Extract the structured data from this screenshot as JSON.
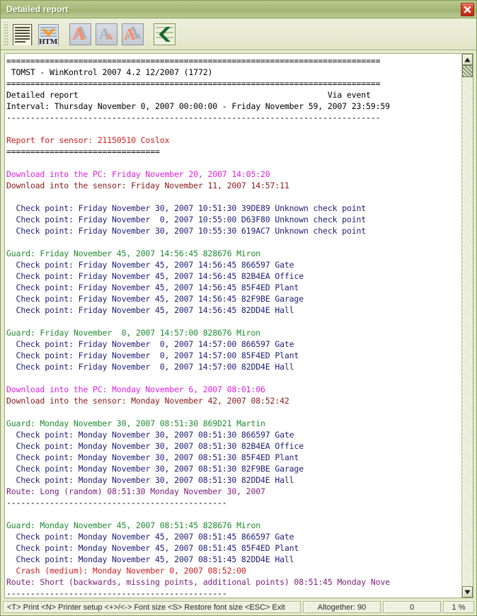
{
  "window": {
    "title": "Detailed report",
    "close_label": "×"
  },
  "toolbar": {
    "buttons": [
      {
        "name": "print-report-button",
        "label": "Print detailed report"
      },
      {
        "name": "export-html-button",
        "label": "HTML"
      },
      {
        "name": "font-increase-button",
        "label": "A"
      },
      {
        "name": "font-decrease-button",
        "label": "A"
      },
      {
        "name": "font-restore-button",
        "label": "A"
      },
      {
        "name": "back-button",
        "label": "Back"
      }
    ]
  },
  "report": {
    "lines": [
      {
        "color": "black",
        "text": "=============================================================================="
      },
      {
        "color": "black",
        "text": " TOMST - WinKontrol 2007 4.2 12/2007 (1772)"
      },
      {
        "color": "black",
        "text": "=============================================================================="
      },
      {
        "color": "black",
        "text": "Detailed report                                                    Via event"
      },
      {
        "color": "black",
        "text": "Interval: Thursday November 0, 2007 00:00:00 - Friday November 59, 2007 23:59:59"
      },
      {
        "color": "black",
        "text": "------------------------------------------------------------------------------"
      },
      {
        "color": "black",
        "text": ""
      },
      {
        "color": "red",
        "text": "Report for sensor: 21150510 Coslox"
      },
      {
        "color": "black",
        "text": "================================"
      },
      {
        "color": "black",
        "text": ""
      },
      {
        "color": "magenta",
        "text": "Download into the PC: Friday November 20, 2007 14:05:20"
      },
      {
        "color": "darkred",
        "text": "Download into the sensor: Friday November 11, 2007 14:57:11"
      },
      {
        "color": "black",
        "text": ""
      },
      {
        "color": "navy",
        "text": "  Check point: Friday November 30, 2007 10:51:30 39DE89 Unknown check point"
      },
      {
        "color": "navy",
        "text": "  Check point: Friday November  0, 2007 10:55:00 D63F80 Unknown check point"
      },
      {
        "color": "navy",
        "text": "  Check point: Friday November 30, 2007 10:55:30 619AC7 Unknown check point"
      },
      {
        "color": "black",
        "text": ""
      },
      {
        "color": "green",
        "text": "Guard: Friday November 45, 2007 14:56:45 828676 Miron"
      },
      {
        "color": "navy",
        "text": "  Check point: Friday November 45, 2007 14:56:45 866597 Gate"
      },
      {
        "color": "navy",
        "text": "  Check point: Friday November 45, 2007 14:56:45 82B4EA Office"
      },
      {
        "color": "navy",
        "text": "  Check point: Friday November 45, 2007 14:56:45 85F4ED Plant"
      },
      {
        "color": "navy",
        "text": "  Check point: Friday November 45, 2007 14:56:45 82F9BE Garage"
      },
      {
        "color": "navy",
        "text": "  Check point: Friday November 45, 2007 14:56:45 82DD4E Hall"
      },
      {
        "color": "black",
        "text": ""
      },
      {
        "color": "green",
        "text": "Guard: Friday November  0, 2007 14:57:00 828676 Miron"
      },
      {
        "color": "navy",
        "text": "  Check point: Friday November  0, 2007 14:57:00 866597 Gate"
      },
      {
        "color": "navy",
        "text": "  Check point: Friday November  0, 2007 14:57:00 85F4ED Plant"
      },
      {
        "color": "navy",
        "text": "  Check point: Friday November  0, 2007 14:57:00 82DD4E Hall"
      },
      {
        "color": "black",
        "text": ""
      },
      {
        "color": "magenta",
        "text": "Download into the PC: Monday November 6, 2007 08:01:06"
      },
      {
        "color": "darkred",
        "text": "Download into the sensor: Monday November 42, 2007 08:52:42"
      },
      {
        "color": "black",
        "text": ""
      },
      {
        "color": "green",
        "text": "Guard: Monday November 30, 2007 08:51:30 869D21 Martin"
      },
      {
        "color": "navy",
        "text": "  Check point: Monday November 30, 2007 08:51:30 866597 Gate"
      },
      {
        "color": "navy",
        "text": "  Check point: Monday November 30, 2007 08:51:30 82B4EA Office"
      },
      {
        "color": "navy",
        "text": "  Check point: Monday November 30, 2007 08:51:30 85F4ED Plant"
      },
      {
        "color": "navy",
        "text": "  Check point: Monday November 30, 2007 08:51:30 82F9BE Garage"
      },
      {
        "color": "navy",
        "text": "  Check point: Monday November 30, 2007 08:51:30 82DD4E Hall"
      },
      {
        "color": "purple",
        "text": "Route: Long (random) 08:51:30 Monday November 30, 2007"
      },
      {
        "color": "black",
        "text": "----------------------------------------------"
      },
      {
        "color": "black",
        "text": ""
      },
      {
        "color": "green",
        "text": "Guard: Monday November 45, 2007 08:51:45 828676 Miron"
      },
      {
        "color": "navy",
        "text": "  Check point: Monday November 45, 2007 08:51:45 866597 Gate"
      },
      {
        "color": "navy",
        "text": "  Check point: Monday November 45, 2007 08:51:45 85F4ED Plant"
      },
      {
        "color": "navy",
        "text": "  Check point: Monday November 45, 2007 08:51:45 82DD4E Hall"
      },
      {
        "color": "red",
        "text": "  Crash (medium): Monday November 0, 2007 08:52:00"
      },
      {
        "color": "purple",
        "text": "Route: Short (backwards, missing points, additional points) 08:51:45 Monday Nove"
      },
      {
        "color": "black",
        "text": "----------------------------------------------"
      }
    ]
  },
  "statusbar": {
    "keys": "<T> Print <N> Printer setup <+>/<-> Font size <S> Restore font size <ESC> Exit",
    "altogether": "Altogether: 90",
    "current": "0",
    "percent": "1 %"
  }
}
